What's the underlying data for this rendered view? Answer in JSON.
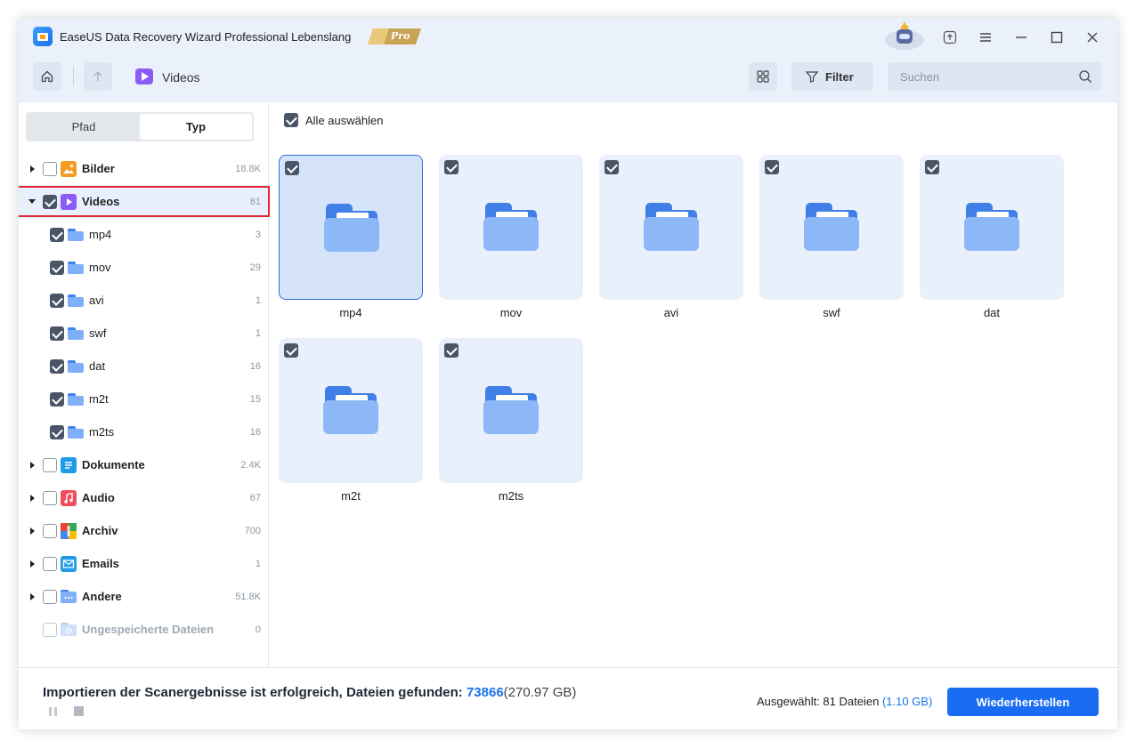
{
  "app": {
    "title": "EaseUS Data Recovery Wizard Professional Lebenslang",
    "badge": "Pro"
  },
  "toolbar": {
    "breadcrumb": "Videos",
    "filter_label": "Filter",
    "search_placeholder": "Suchen"
  },
  "sidebar": {
    "tabs": [
      {
        "label": "Pfad",
        "active": false
      },
      {
        "label": "Typ",
        "active": true
      }
    ],
    "items": [
      {
        "label": "Bilder",
        "count": "18.8K",
        "checked": false,
        "expanded": false
      },
      {
        "label": "Videos",
        "count": "81",
        "checked": true,
        "expanded": true,
        "selected": true
      },
      {
        "label": "mp4",
        "count": "3",
        "checked": true
      },
      {
        "label": "mov",
        "count": "29",
        "checked": true
      },
      {
        "label": "avi",
        "count": "1",
        "checked": true
      },
      {
        "label": "swf",
        "count": "1",
        "checked": true
      },
      {
        "label": "dat",
        "count": "16",
        "checked": true
      },
      {
        "label": "m2t",
        "count": "15",
        "checked": true
      },
      {
        "label": "m2ts",
        "count": "16",
        "checked": true
      },
      {
        "label": "Dokumente",
        "count": "2.4K",
        "checked": false,
        "expanded": false
      },
      {
        "label": "Audio",
        "count": "67",
        "checked": false,
        "expanded": false
      },
      {
        "label": "Archiv",
        "count": "700",
        "checked": false,
        "expanded": false
      },
      {
        "label": "Emails",
        "count": "1",
        "checked": false,
        "expanded": false
      },
      {
        "label": "Andere",
        "count": "51.8K",
        "checked": false,
        "expanded": false
      },
      {
        "label": "Ungespeicherte Dateien",
        "count": "0",
        "checked": false,
        "disabled": true
      }
    ]
  },
  "main": {
    "select_all_label": "Alle auswählen",
    "tiles": [
      {
        "label": "mp4",
        "checked": true,
        "active": true
      },
      {
        "label": "mov",
        "checked": true
      },
      {
        "label": "avi",
        "checked": true
      },
      {
        "label": "swf",
        "checked": true
      },
      {
        "label": "dat",
        "checked": true
      },
      {
        "label": "m2t",
        "checked": true
      },
      {
        "label": "m2ts",
        "checked": true
      }
    ]
  },
  "footer": {
    "status_prefix": "Importieren der Scanergebnisse ist erfolgreich, Dateien gefunden: ",
    "found_count": "73866",
    "found_size": "(270.97 GB)",
    "selected_prefix": "Ausgewählt: 81 Dateien ",
    "selected_size": "(1.10 GB)",
    "recover_label": "Wiederherstellen"
  },
  "colors": {
    "accent": "#1a6cf2",
    "highlight_border": "#e2272e",
    "videos_icon": "#8b5cf6"
  }
}
